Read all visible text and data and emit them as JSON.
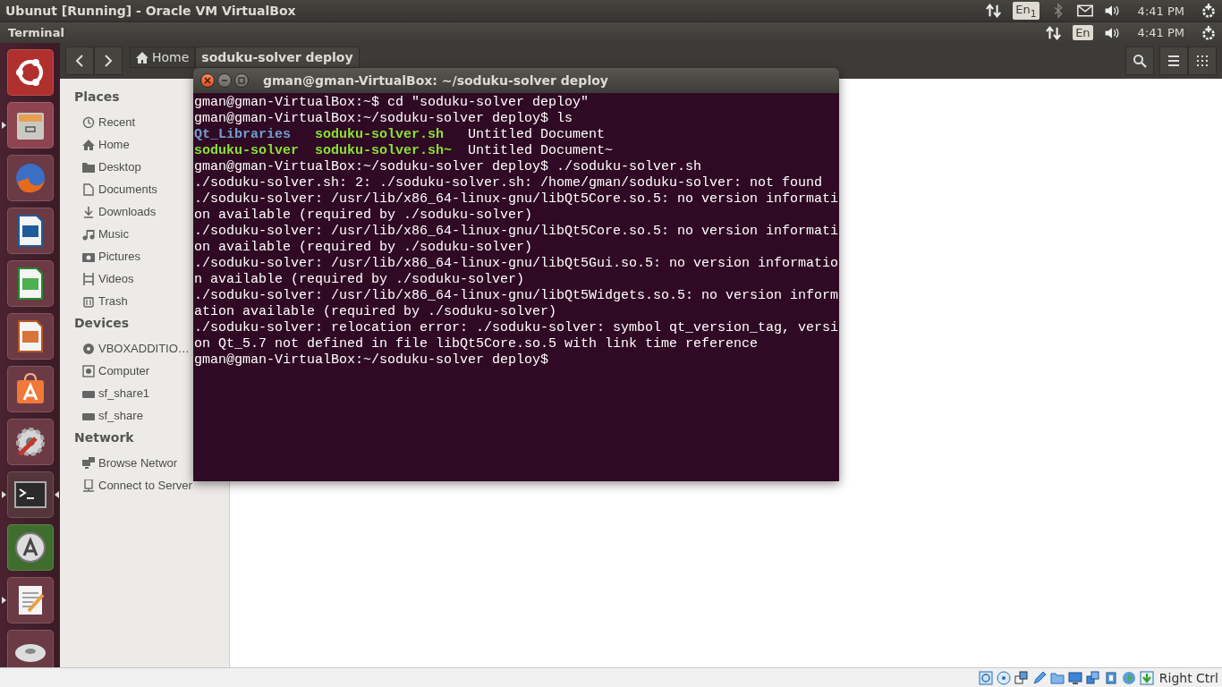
{
  "vbox": {
    "title": "Ubunut [Running] - Oracle VM VirtualBox",
    "keyboard": "En$_{1}$",
    "clock": "4:41 PM",
    "host_key": "Right Ctrl"
  },
  "panel": {
    "app": "Terminal",
    "keyboard": "En",
    "clock": "4:41 PM"
  },
  "launcher": [
    {
      "running": false,
      "focused": false
    },
    {
      "running": true,
      "focused": false
    },
    {
      "running": false,
      "focused": false
    },
    {
      "running": false,
      "focused": false
    },
    {
      "running": false,
      "focused": false
    },
    {
      "running": false,
      "focused": false
    },
    {
      "running": false,
      "focused": false
    },
    {
      "running": false,
      "focused": false
    },
    {
      "running": true,
      "focused": true
    },
    {
      "running": false,
      "focused": false
    },
    {
      "running": true,
      "focused": false
    },
    {
      "running": false,
      "focused": false
    }
  ],
  "files": {
    "path": [
      {
        "label": "Home",
        "selected": false
      },
      {
        "label": "soduku-solver deploy",
        "selected": true
      }
    ],
    "sidebar": [
      {
        "heading": "Places",
        "items": [
          "Recent",
          "Home",
          "Desktop",
          "Documents",
          "Downloads",
          "Music",
          "Pictures",
          "Videos",
          "Trash"
        ]
      },
      {
        "heading": "Devices",
        "items": [
          "VBOXADDITIO…",
          "Computer",
          "sf_share1",
          "sf_share"
        ]
      },
      {
        "heading": "Network",
        "items": [
          "Browse Networ",
          "Connect to Server"
        ]
      }
    ]
  },
  "terminal": {
    "title": "gman@gman-VirtualBox: ~/soduku-solver deploy",
    "lines": [
      {
        "kind": "text",
        "text": "gman@gman-VirtualBox:~$ cd \"soduku-solver deploy\""
      },
      {
        "kind": "text",
        "text": "gman@gman-VirtualBox:~/soduku-solver deploy$ ls"
      },
      {
        "kind": "files",
        "cells": [
          {
            "text": "Qt_Libraries",
            "kind": "dir"
          },
          {
            "text": "soduku-solver.sh",
            "kind": "exec"
          },
          {
            "text": "Untitled Document",
            "kind": "file"
          }
        ]
      },
      {
        "kind": "files",
        "cells": [
          {
            "text": "soduku-solver",
            "kind": "exec"
          },
          {
            "text": "soduku-solver.sh~",
            "kind": "exec"
          },
          {
            "text": "Untitled Document~",
            "kind": "file"
          }
        ]
      },
      {
        "kind": "text",
        "text": "gman@gman-VirtualBox:~/soduku-solver deploy$ ./soduku-solver.sh"
      },
      {
        "kind": "text",
        "text": "./soduku-solver.sh: 2: ./soduku-solver.sh: /home/gman/soduku-solver: not found"
      },
      {
        "kind": "text",
        "text": "./soduku-solver: /usr/lib/x86_64-linux-gnu/libQt5Core.so.5: no version informati"
      },
      {
        "kind": "text",
        "text": "on available (required by ./soduku-solver)"
      },
      {
        "kind": "text",
        "text": "./soduku-solver: /usr/lib/x86_64-linux-gnu/libQt5Core.so.5: no version informati"
      },
      {
        "kind": "text",
        "text": "on available (required by ./soduku-solver)"
      },
      {
        "kind": "text",
        "text": "./soduku-solver: /usr/lib/x86_64-linux-gnu/libQt5Gui.so.5: no version informatio"
      },
      {
        "kind": "text",
        "text": "n available (required by ./soduku-solver)"
      },
      {
        "kind": "text",
        "text": "./soduku-solver: /usr/lib/x86_64-linux-gnu/libQt5Widgets.so.5: no version inform"
      },
      {
        "kind": "text",
        "text": "ation available (required by ./soduku-solver)"
      },
      {
        "kind": "text",
        "text": "./soduku-solver: relocation error: ./soduku-solver: symbol qt_version_tag, versi"
      },
      {
        "kind": "text",
        "text": "on Qt_5.7 not defined in file libQt5Core.so.5 with link time reference"
      },
      {
        "kind": "text",
        "text": "gman@gman-VirtualBox:~/soduku-solver deploy$"
      }
    ]
  }
}
